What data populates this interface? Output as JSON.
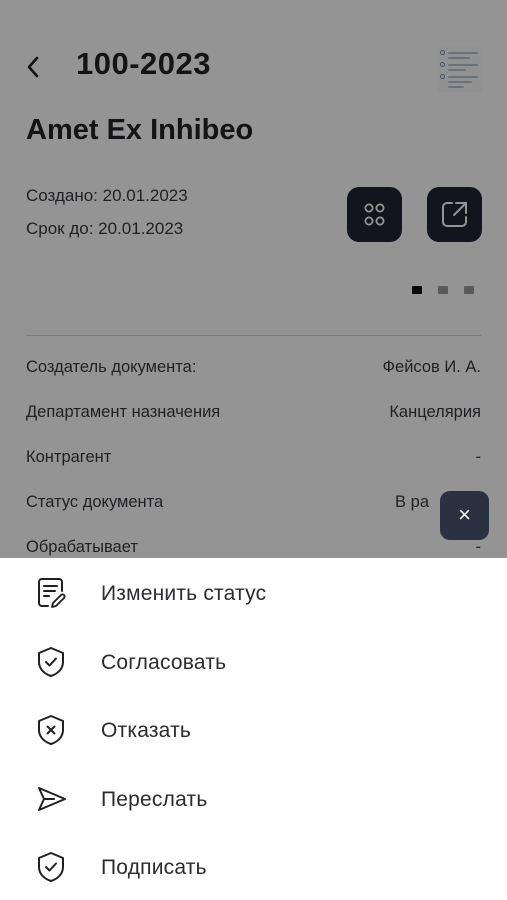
{
  "header": {
    "doc_number": "100-2023"
  },
  "document": {
    "title": "Amet Ex Inhibeo",
    "created": "Создано: 20.01.2023",
    "due": "Срок до: 20.01.2023"
  },
  "pager": {
    "total": 3,
    "active": 1
  },
  "details": [
    {
      "key": "Создатель документа:",
      "value": "Фейсов И. А."
    },
    {
      "key": "Департамент назначения",
      "value": "Канцелярия"
    },
    {
      "key": "Контрагент",
      "value": "-"
    },
    {
      "key": "Статус документа",
      "value": "В ра"
    },
    {
      "key": "Обрабатывает",
      "value": "-"
    }
  ],
  "fab": {
    "close_glyph": "×"
  },
  "menu": [
    {
      "label": "Изменить статус",
      "icon": "edit-document-icon"
    },
    {
      "label": "Согласовать",
      "icon": "shield-check-icon"
    },
    {
      "label": "Отказать",
      "icon": "shield-cross-icon"
    },
    {
      "label": "Переслать",
      "icon": "send-icon"
    },
    {
      "label": "Подписать",
      "icon": "shield-check-icon"
    }
  ],
  "colors": {
    "dark_button": "#1f2530",
    "overlay": "rgba(0,0,0,0.42)",
    "text": "#2b2b30"
  }
}
